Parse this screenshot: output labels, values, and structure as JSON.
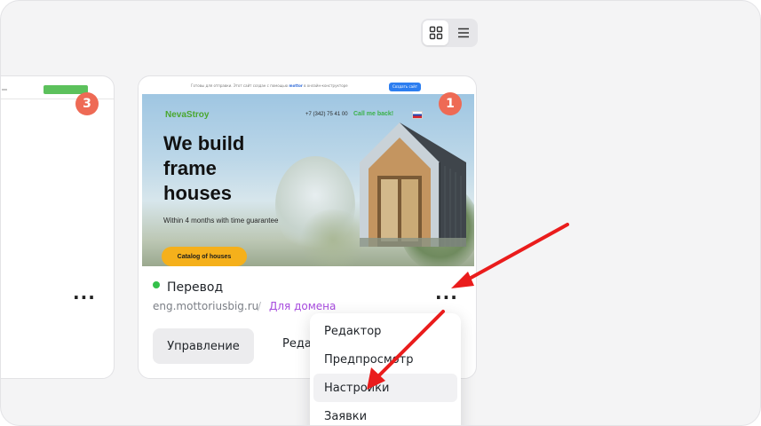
{
  "view_toggle": {
    "grid_icon": "grid-icon",
    "list_icon": "list-icon",
    "active": "grid"
  },
  "left_card": {
    "badge": "3",
    "more_label": "..."
  },
  "main_card": {
    "badge": "1",
    "preview": {
      "topbar_text_prefix": "Готовы для отправки. Этот сайт создан с помощью",
      "topbar_brand": "mottor",
      "topbar_text_suffix": "в онлайн-конструкторе",
      "topbar_button": "Создать сайт",
      "logo": "NevaStroy",
      "phone": "+7 (342) 75 41 00",
      "call_label": "Call me back!",
      "hero_title": "We build\nframe\nhouses",
      "hero_subtitle": "Within 4 months with time guarantee",
      "hero_cta": "Catalog of houses",
      "flag_icon": "russia-flag-icon"
    },
    "status_color": "#34c04a",
    "title": "Перевод",
    "domain": "eng.mottoriusbig.ru",
    "separator": "/",
    "domain_link": "Для домена",
    "more_label": "...",
    "manage_button": "Управление",
    "edit_button": "Редактор"
  },
  "context_menu": {
    "items": [
      {
        "label": "Редактор"
      },
      {
        "label": "Предпросмотр"
      },
      {
        "label": "Настройки"
      },
      {
        "label": "Заявки"
      }
    ]
  },
  "colors": {
    "accent_red": "#ee6a55",
    "arrow_red": "#ea1c1c",
    "link_purple": "#a74bde",
    "status_green": "#34c04a"
  }
}
